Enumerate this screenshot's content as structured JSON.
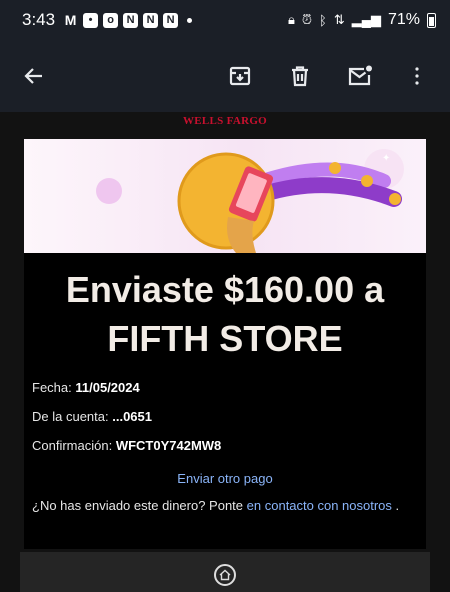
{
  "status_bar": {
    "time": "3:43",
    "battery_percent": "71%",
    "notification_icons": [
      "gmail-icon",
      "message-icon",
      "outlook-icon",
      "app-n-icon",
      "app-n-icon",
      "app-n-icon"
    ]
  },
  "toolbar": {
    "actions": [
      "back",
      "archive",
      "delete",
      "mark-unread",
      "more"
    ]
  },
  "email": {
    "brand": "WELLS FARGO",
    "headline_line1": "Enviaste $160.00 a",
    "headline_line2": "FIFTH STORE",
    "date_label": "Fecha:",
    "date_value": "11/05/2024",
    "account_label": "De la cuenta:",
    "account_value": "...0651",
    "confirmation_label": "Confirmación:",
    "confirmation_value": "WFCT0Y742MW8",
    "send_again_link": "Enviar otro pago",
    "not_sent_text": "¿No has enviado este dinero? Ponte",
    "contact_link": "en contacto con nosotros",
    "trailing_period": "."
  },
  "colors": {
    "brand_red": "#c8102e",
    "link_blue": "#8ab4f8",
    "hero_gold": "#f3b431",
    "hero_purple": "#8e3cc9"
  }
}
